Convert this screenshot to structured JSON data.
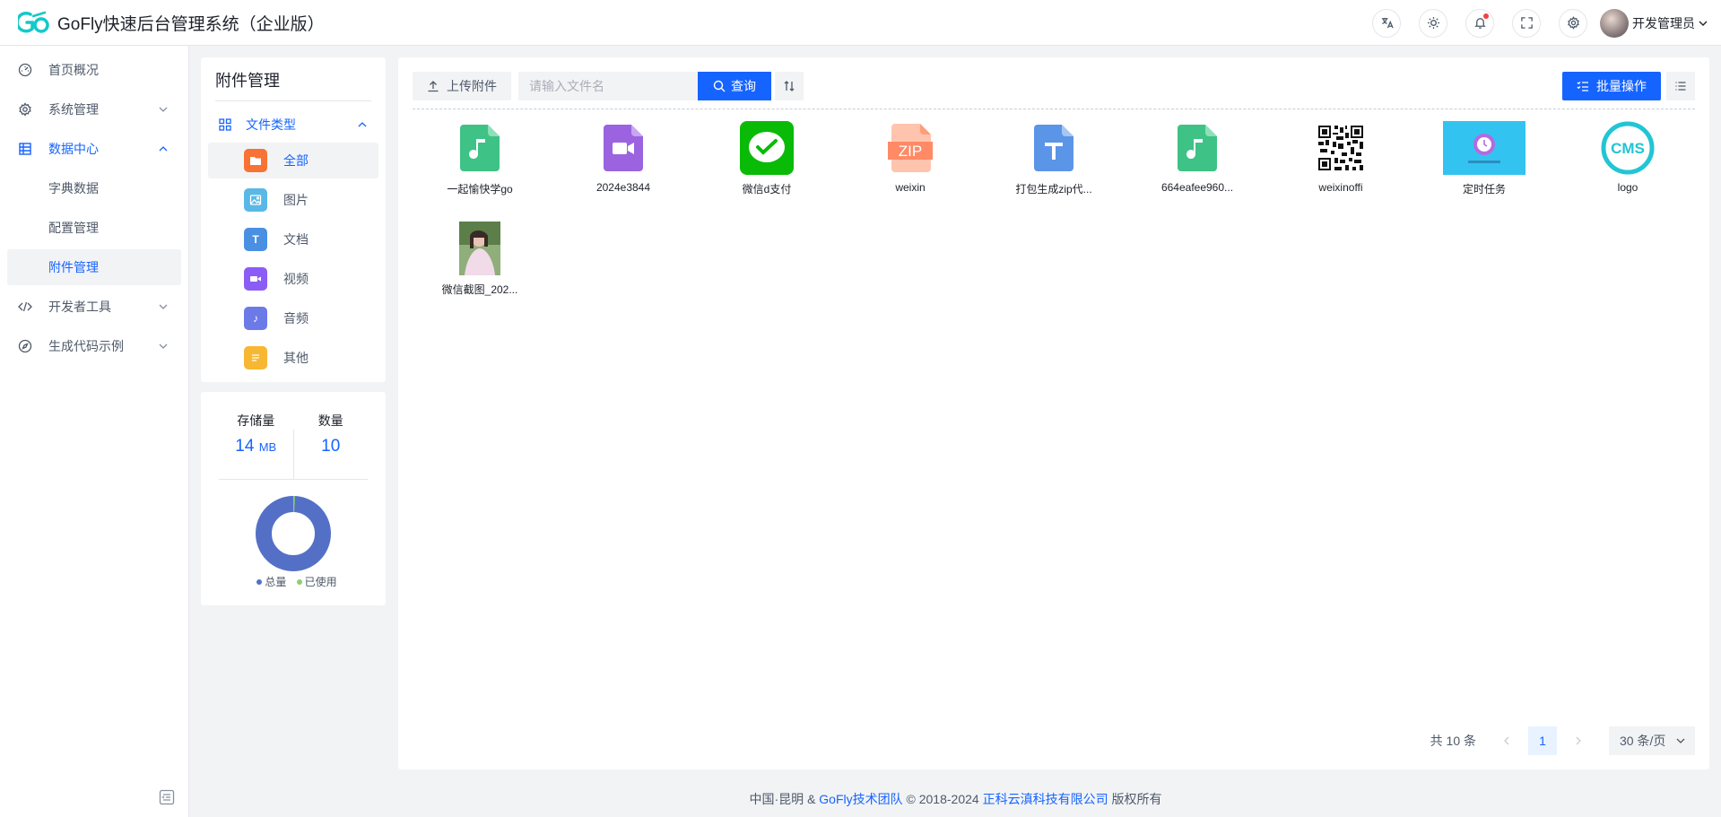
{
  "app": {
    "title": "GoFly快速后台管理系统（企业版）",
    "user_name": "开发管理员"
  },
  "header_icons": [
    "translate-icon",
    "theme-icon",
    "bell-icon",
    "fullscreen-icon",
    "gear-icon"
  ],
  "sidebar": {
    "items": [
      {
        "label": "首页概况",
        "icon": "dashboard-icon"
      },
      {
        "label": "系统管理",
        "icon": "gear-icon"
      },
      {
        "label": "数据中心",
        "icon": "database-icon"
      },
      {
        "label": "字典数据"
      },
      {
        "label": "配置管理"
      },
      {
        "label": "附件管理"
      },
      {
        "label": "开发者工具",
        "icon": "code-icon"
      },
      {
        "label": "生成代码示例",
        "icon": "compass-icon"
      }
    ]
  },
  "type_panel": {
    "title": "附件管理",
    "header": "文件类型",
    "items": [
      {
        "label": "全部",
        "color": "#f77234"
      },
      {
        "label": "图片",
        "color": "#5ab8e6"
      },
      {
        "label": "文档",
        "color": "#4a90e2"
      },
      {
        "label": "视频",
        "color": "#8b5cf6"
      },
      {
        "label": "音频",
        "color": "#6c7ae8"
      },
      {
        "label": "其他",
        "color": "#f7b733"
      }
    ]
  },
  "stats": {
    "storage_label": "存储量",
    "storage_value": "14",
    "storage_unit": "MB",
    "count_label": "数量",
    "count_value": "10",
    "legend_total": "总量",
    "legend_used": "已使用"
  },
  "toolbar": {
    "upload_label": "上传附件",
    "search_placeholder": "请输入文件名",
    "search_label": "查询",
    "batch_label": "批量操作"
  },
  "files": [
    {
      "name": "一起愉快学go",
      "kind": "audio"
    },
    {
      "name": "2024e3844",
      "kind": "video"
    },
    {
      "name": "微信d支付",
      "kind": "wechat"
    },
    {
      "name": "weixin",
      "kind": "zip"
    },
    {
      "name": "打包生成zip代...",
      "kind": "doc"
    },
    {
      "name": "664eafee960...",
      "kind": "audio"
    },
    {
      "name": "weixinoffi",
      "kind": "qrcode"
    },
    {
      "name": "定时任务",
      "kind": "banner"
    },
    {
      "name": "logo",
      "kind": "cms"
    },
    {
      "name": "微信截图_202...",
      "kind": "photo"
    }
  ],
  "pagination": {
    "total": "共 10 条",
    "current": "1",
    "page_size": "30 条/页"
  },
  "footer": {
    "prefix": "中国·昆明 &",
    "team": "GoFly技术团队",
    "copy": "© 2018-2024",
    "company": "正科云滇科技有限公司",
    "suffix": "版权所有"
  }
}
